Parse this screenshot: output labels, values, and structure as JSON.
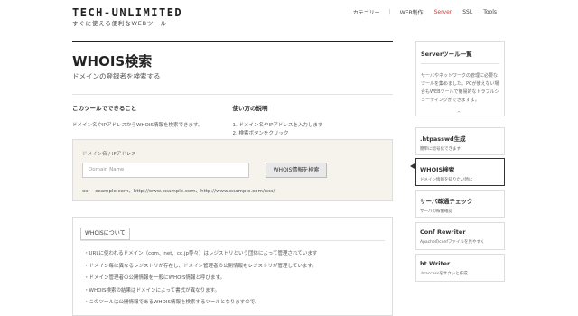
{
  "header": {
    "logo": "TECH-UNLIMITED",
    "tagline": "すぐに使える便利なWEBツール",
    "nav": [
      "カテゴリー",
      "WEB制作",
      "Server",
      "SSL",
      "Tools"
    ]
  },
  "main": {
    "title": "WHOIS検索",
    "subtitle": "ドメインの登録者を検索する",
    "can_do_title": "このツールでできること",
    "can_do_text": "ドメイン名やIPアドレスからWHOIS情報を検索できます。",
    "howto_title": "使い方の説明",
    "howto_steps": [
      "1. ドメイン名やIPアドレスを入力します",
      "2. 検索ボタンをクリック"
    ],
    "form": {
      "label": "ドメイン名 / IPアドレス",
      "placeholder": "Domain Name",
      "button": "WHOIS情報を検索",
      "example": "ex)　example.com、http://www.example.com、http://www.example.com/xxx/"
    },
    "about": {
      "title": "WHOISについて",
      "items": [
        "・URLに使われるドメイン（com、net、co.jp等々）はレジストリという団体によって管理されています",
        "・ドメイン毎に異なるレジストリが存在し、ドメイン管理者の公開情報もレジストリが管理しています。",
        "・ドメイン管理者の公開情報を一般にWHOIS情報と呼びます。",
        "・WHOIS検索の結果はドメインによって書式が異なります。",
        "・このツールは公開情報であるWHOIS情報を検索するツールとなりますので、"
      ]
    }
  },
  "sidebar": {
    "title": "Serverツール一覧",
    "desc": "サーバやネットワークの管理に必要なツールを集めました。PCが使えない場合もWEBツールで簡易的なトラブルシューティングができますよ。",
    "caret": "^",
    "items": [
      {
        "title": ".htpasswd生成",
        "desc": "簡単に暗号化できます"
      },
      {
        "title": "WHOIS検索",
        "desc": "ドメイン情報を知りたい時に"
      },
      {
        "title": "サーバ疎通チェック",
        "desc": "サーバの稼働確認"
      },
      {
        "title": "Conf Rewriter",
        "desc": "Apacheのconfファイルを見やすく"
      },
      {
        "title": "ht Writer",
        "desc": ".htaccessをサクッと作成"
      }
    ]
  }
}
